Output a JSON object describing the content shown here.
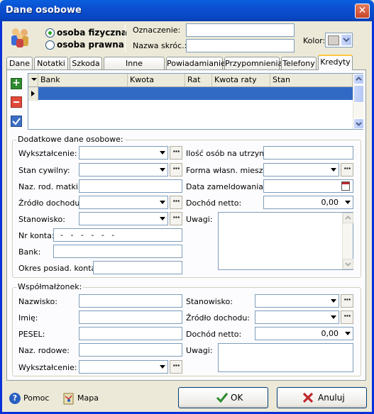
{
  "window": {
    "title": "Dane osobowe",
    "close_glyph": "✕"
  },
  "person_type": {
    "options": [
      {
        "label": "osoba fizyczna",
        "selected": true
      },
      {
        "label": "osoba prawna",
        "selected": false
      }
    ]
  },
  "header": {
    "oznaczenie_label": "Oznaczenie:",
    "oznaczenie_value": "",
    "nazwa_label": "Nazwa skróc.:",
    "nazwa_value": "",
    "kolor_label": "Kolor:"
  },
  "tabs": [
    {
      "label": "Dane",
      "active": false
    },
    {
      "label": "Notatki",
      "active": false
    },
    {
      "label": "Szkoda",
      "active": false
    },
    {
      "label": "Inne dokumenty",
      "active": false
    },
    {
      "label": "Powiadamianie",
      "active": false
    },
    {
      "label": "Przypomnienia",
      "active": false
    },
    {
      "label": "Telefony",
      "active": false
    },
    {
      "label": "Kredyty",
      "active": true
    }
  ],
  "grid": {
    "columns": [
      "Bank",
      "Kwota",
      "Rat",
      "Kwota raty",
      "Stan"
    ],
    "rows": []
  },
  "extra": {
    "legend": "Dodatkowe dane osobowe:",
    "wyksztalcenie": "Wykształcenie:",
    "stan_cywilny": "Stan cywilny:",
    "naz_rod_matki": "Naz. rod. matki:",
    "zrodlo_dochodu": "Źródło dochodu:",
    "stanowisko": "Stanowisko:",
    "nr_konta": "Nr konta:",
    "nr_konta_value": "  -   -   -   -   -   -",
    "bank": "Bank:",
    "okres": "Okres posiad. konta:",
    "ilosc_osob": "Ilość osób na utrzym.:",
    "forma": "Forma własn. mieszk.:",
    "data_zameldowania": "Data zameldowania:",
    "dochod_netto": "Dochód netto:",
    "dochod_value": "0,00",
    "uwagi": "Uwagi:"
  },
  "spouse": {
    "legend": "Współmałżonek:",
    "nazwisko": "Nazwisko:",
    "imie": "Imię:",
    "pesel": "PESEL:",
    "naz_rodowe": "Naz. rodowe:",
    "wyksztalcenie": "Wykształcenie:",
    "stanowisko": "Stanowisko:",
    "zrodlo_dochodu": "Źródło dochodu:",
    "dochod_netto": "Dochód netto:",
    "dochod_value": "0,00",
    "uwagi": "Uwagi:"
  },
  "footer": {
    "pomoc": "Pomoc",
    "mapa": "Mapa",
    "ok": "OK",
    "anuluj": "Anuluj"
  },
  "colors": {
    "accent": "#0b4fd0",
    "selection": "#316ac5",
    "ok_check": "#2d8a2d",
    "cancel_x": "#c0282d"
  }
}
